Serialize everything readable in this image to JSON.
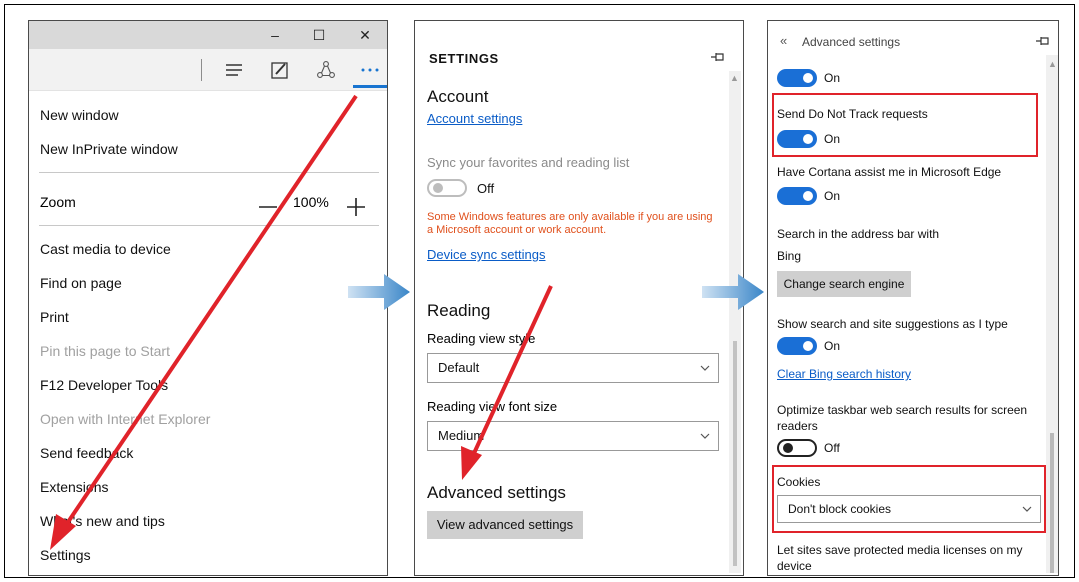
{
  "panel1": {
    "window_controls": [
      "–",
      "☐",
      "✕"
    ],
    "zoom": {
      "label": "Zoom",
      "value": "100%"
    },
    "menu_items_top": [
      "New window",
      "New InPrivate window"
    ],
    "menu_items_mid": [
      "Cast media to device",
      "Find on page",
      "Print",
      "Pin this page to Start",
      "F12 Developer Tools",
      "Open with Internet Explorer",
      "Send feedback",
      "Extensions",
      "What's new and tips",
      "Settings"
    ]
  },
  "panel2": {
    "header": "SETTINGS",
    "account_heading": "Account",
    "account_link": "Account settings",
    "sync_label": "Sync your favorites and reading list",
    "sync_state": "Off",
    "warning": "Some Windows features are only available if you are using a Microsoft account or work account.",
    "device_sync_link": "Device sync settings",
    "reading_heading": "Reading",
    "reading_view_style_label": "Reading view style",
    "reading_view_style_value": "Default",
    "font_size_label": "Reading view font size",
    "font_size_value": "Medium",
    "advanced_heading": "Advanced settings",
    "advanced_button": "View advanced settings"
  },
  "panel3": {
    "back_title": "Advanced settings",
    "top_toggle_state": "On",
    "dnt_label": "Send Do Not Track requests",
    "dnt_state": "On",
    "cortana_label": "Have Cortana assist me in Microsoft Edge",
    "cortana_state": "On",
    "search_label": "Search in the address bar with",
    "search_engine": "Bing",
    "change_engine_button": "Change search engine",
    "suggestions_label": "Show search and site suggestions as I type",
    "suggestions_state": "On",
    "clear_history_link": "Clear Bing search history",
    "optimize_label_1": "Optimize taskbar web search results for screen",
    "optimize_label_2": "readers",
    "optimize_state": "Off",
    "cookies_label": "Cookies",
    "cookies_value": "Don't block cookies",
    "media_label_1": "Let sites save protected media licenses on my",
    "media_label_2": "device"
  },
  "colors": {
    "accent": "#1a6fd6",
    "annotation_red": "#e0232a",
    "arrow_blue": "#3a86c8",
    "warning_orange": "#e0501c"
  }
}
